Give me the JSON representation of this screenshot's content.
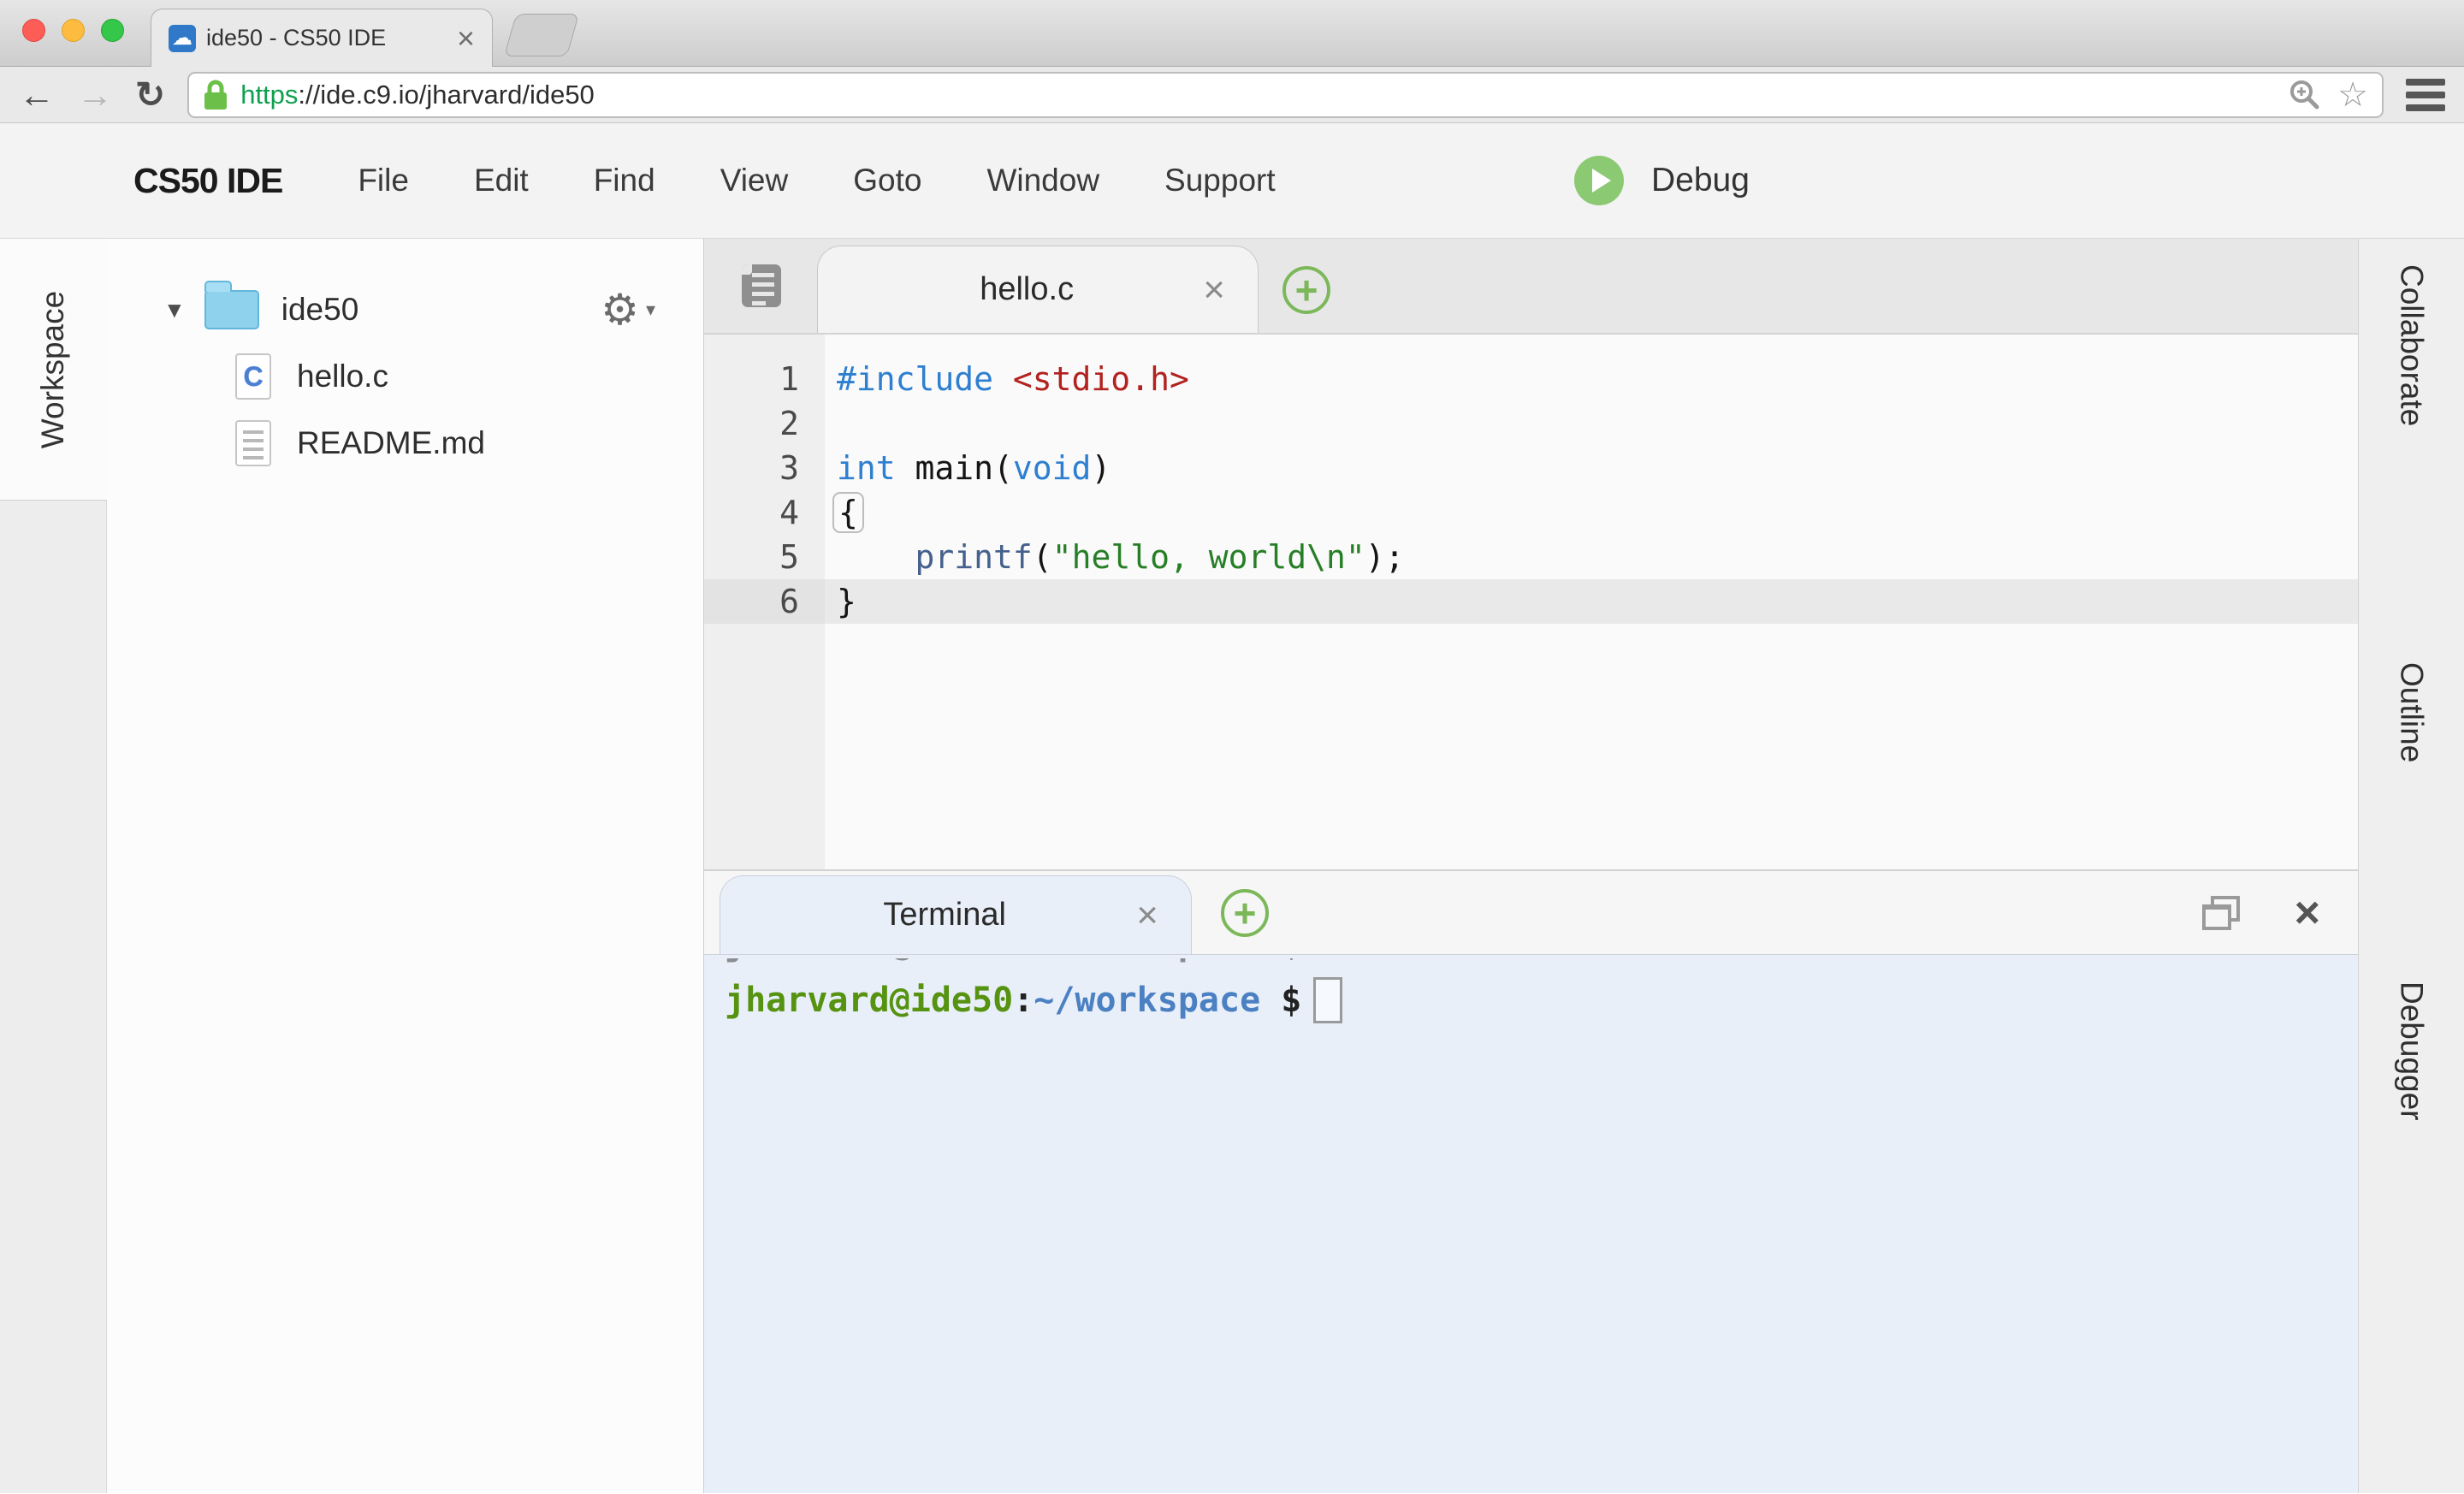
{
  "browser": {
    "tab_title": "ide50 - CS50 IDE",
    "url": {
      "scheme": "https",
      "rest": "://ide.c9.io/jharvard/ide50"
    },
    "icons": {
      "back": "←",
      "forward": "→",
      "reload": "↻",
      "star": "☆",
      "cloud": "☁",
      "close": "×"
    }
  },
  "menu": {
    "brand": "CS50 IDE",
    "items": [
      "File",
      "Edit",
      "Find",
      "View",
      "Goto",
      "Window",
      "Support"
    ],
    "debug_label": "Debug"
  },
  "left_rail": {
    "label": "Workspace"
  },
  "tree": {
    "folder": "ide50",
    "files": [
      "hello.c",
      "README.md"
    ],
    "icons": {
      "disclosure": "▼",
      "gear": "⚙",
      "gear_caret": "▾",
      "c_badge": "C"
    }
  },
  "editor": {
    "tab": "hello.c",
    "tab_close": "×",
    "plus": "+",
    "active_line": 6,
    "lines": [
      {
        "num": 1,
        "segs": [
          {
            "t": "#include",
            "c": "b"
          },
          {
            "t": " ",
            "c": "p"
          },
          {
            "t": "<stdio.h>",
            "c": "r"
          }
        ]
      },
      {
        "num": 2,
        "segs": []
      },
      {
        "num": 3,
        "segs": [
          {
            "t": "int",
            "c": "b"
          },
          {
            "t": " main(",
            "c": "p"
          },
          {
            "t": "void",
            "c": "b"
          },
          {
            "t": ")",
            "c": "p"
          }
        ]
      },
      {
        "num": 4,
        "segs": [
          {
            "t": "{",
            "c": "p",
            "box": true
          }
        ]
      },
      {
        "num": 5,
        "segs": [
          {
            "t": "    ",
            "c": "p"
          },
          {
            "t": "printf",
            "c": "f"
          },
          {
            "t": "(",
            "c": "p"
          },
          {
            "t": "\"hello, world\\n\"",
            "c": "g"
          },
          {
            "t": ")",
            "c": "p"
          },
          {
            "t": ";",
            "c": "p"
          }
        ]
      },
      {
        "num": 6,
        "segs": [
          {
            "t": "}",
            "c": "p"
          }
        ]
      }
    ]
  },
  "terminal": {
    "tab": "Terminal",
    "tab_close": "×",
    "plus": "+",
    "window_close": "×",
    "prompt": [
      {
        "t": "jharvard@ide50",
        "c": "user"
      },
      {
        "t": ":",
        "c": "plain"
      },
      {
        "t": "~/workspace",
        "c": "path"
      },
      {
        "t": " $",
        "c": "plain"
      }
    ]
  },
  "right_rail": {
    "labels": [
      "Collaborate",
      "Outline",
      "Debugger"
    ]
  },
  "colors": {
    "accent_green": "#7cb85a",
    "debug_green": "#8cc973",
    "keyword_blue": "#2e7fd0",
    "include_red": "#b2221f",
    "string_green": "#267f26",
    "function_slate": "#44608c",
    "prompt_green": "#559310",
    "prompt_blue": "#4b80c2",
    "terminal_bg": "#e9eff9",
    "url_scheme_green": "#0ea04e"
  }
}
